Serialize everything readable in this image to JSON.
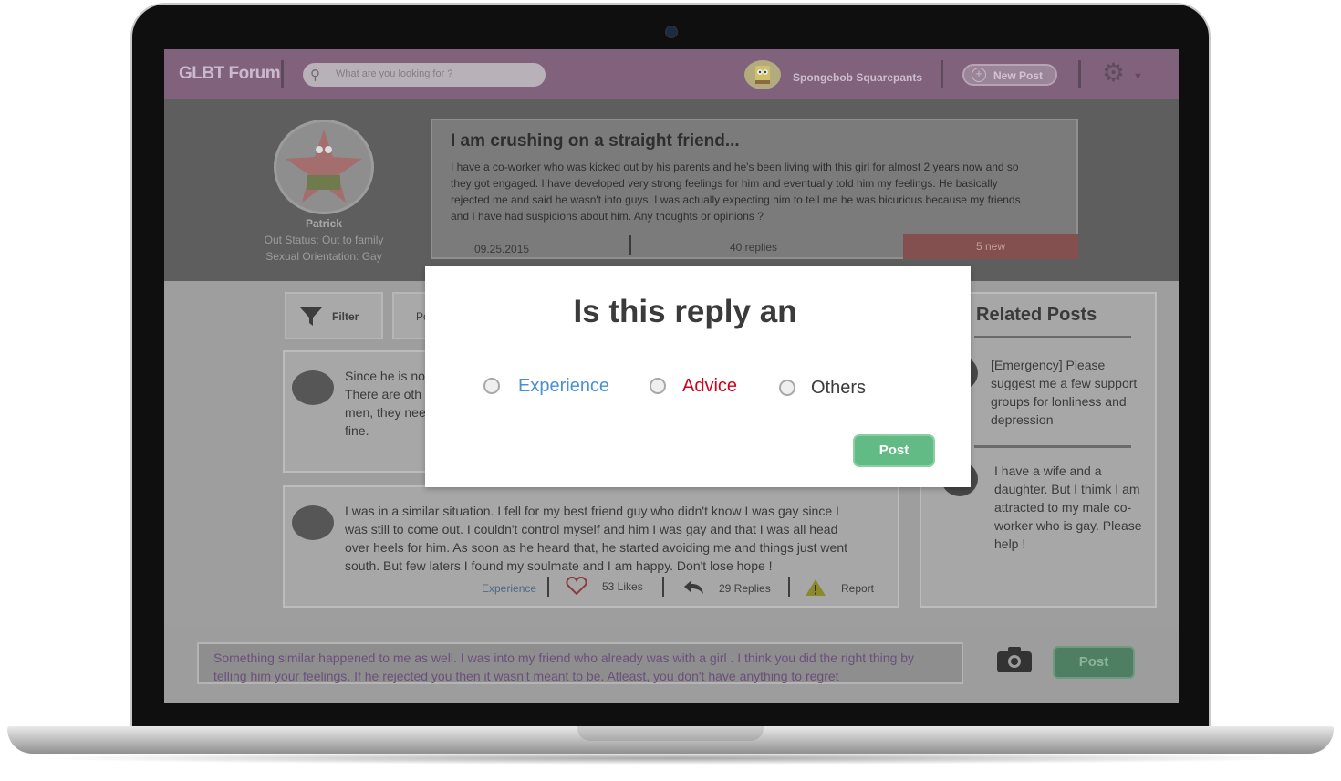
{
  "header": {
    "brand": "GLBT Forum",
    "search_placeholder": "What are you looking for ?",
    "username": "Spongebob Squarepants",
    "new_post_label": "New Post"
  },
  "profile": {
    "name": "Patrick",
    "out_status": "Out Status: Out to family",
    "orientation": "Sexual Orientation: Gay"
  },
  "post": {
    "title": "I am crushing on a straight friend...",
    "body": "I have a co-worker who was kicked out by his parents and he's been living with this girl for almost 2 years now and so they got engaged. I have developed very strong feelings for him and eventually told him my feelings. He basically rejected me and said he wasn't into guys. I was actually expecting him to tell me he was bicurious because my friends and I have had suspicions about him. Any thoughts or opinions ?",
    "date": "09.25.2015",
    "replies": "40 replies",
    "new": "5 new"
  },
  "toolbar": {
    "filter_label": "Filter",
    "sort_label_partial": "Po"
  },
  "replies": [
    {
      "lines": [
        "Since he is no",
        "There are oth",
        "men, they nee",
        "fine."
      ]
    },
    {
      "text": "I was in a similar situation. I fell for my best friend guy who didn't know I was gay since I was still to come out. I couldn't control myself and  him I was gay and that I was all head over heels for him. As soon as he heard that, he started avoiding me and things just went south. But few laters I found my soulmate and I am happy. Don't lose hope !",
      "tag": "Experience",
      "likes": "53 Likes",
      "replies": "29 Replies",
      "report": "Report"
    }
  ],
  "related": {
    "title": "Related Posts",
    "items": [
      "[Emergency] Please suggest me a few support groups for lonliness and depression",
      "I have a wife and a daughter. But I thimk I am attracted to my male co-worker who is gay. Please help !"
    ]
  },
  "composer": {
    "text": "Something similar happened to me as well. I was into my friend who already was with a girl . I think you did the right thing by telling him your feelings. If he rejected you then it wasn't meant to be. Atleast, you don't have anything to regret",
    "post_label": "Post"
  },
  "modal": {
    "title": "Is this reply an",
    "options": [
      {
        "label": "Experience",
        "color": "#4a90d9"
      },
      {
        "label": "Advice",
        "color": "#d0021b"
      },
      {
        "label": "Others",
        "color": "#3b3b3b"
      }
    ],
    "post_label": "Post"
  },
  "colors": {
    "topbar": "#80627d",
    "accent_green": "#62bb84",
    "new_badge": "#844f4f"
  }
}
